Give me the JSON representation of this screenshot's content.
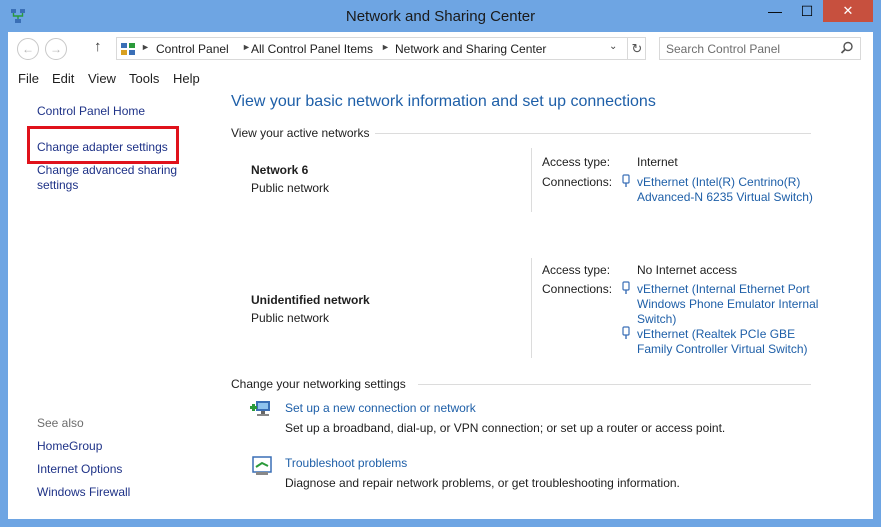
{
  "window": {
    "title": "Network and Sharing Center",
    "minimize_glyph": "—",
    "maximize_glyph": "☐",
    "close_glyph": "✕"
  },
  "navbar": {
    "back_glyph": "←",
    "forward_glyph": "→",
    "up_glyph": "↑",
    "breadcrumb": [
      "Control Panel",
      "All Control Panel Items",
      "Network and Sharing Center"
    ],
    "separator": "►",
    "dropdown_glyph": "⌄",
    "refresh_glyph": "↻",
    "search_placeholder": "Search Control Panel"
  },
  "menu": [
    "File",
    "Edit",
    "View",
    "Tools",
    "Help"
  ],
  "sidebar": {
    "home": "Control Panel Home",
    "change_adapter": "Change adapter settings",
    "change_sharing": "Change advanced sharing settings",
    "see_also_label": "See also",
    "see_also": [
      "HomeGroup",
      "Internet Options",
      "Windows Firewall"
    ]
  },
  "main": {
    "title": "View your basic network information and set up connections",
    "active_networks_label": "View your active networks",
    "networks": [
      {
        "name": "Network  6",
        "type": "Public network",
        "access_label": "Access type:",
        "access_value": "Internet",
        "connections_label": "Connections:",
        "connections": [
          "vEthernet (Intel(R) Centrino(R) Advanced-N 6235 Virtual Switch)"
        ]
      },
      {
        "name": "Unidentified network",
        "type": "Public network",
        "access_label": "Access type:",
        "access_value": "No Internet access",
        "connections_label": "Connections:",
        "connections": [
          "vEthernet (Internal Ethernet Port Windows Phone Emulator Internal Switch)",
          "vEthernet (Realtek PCIe GBE Family Controller Virtual Switch)"
        ]
      }
    ],
    "change_settings_label": "Change your networking settings",
    "tasks": [
      {
        "icon": "new-connection-icon",
        "link": "Set up a new connection or network",
        "description": "Set up a broadband, dial-up, or VPN connection; or set up a router or access point."
      },
      {
        "icon": "troubleshoot-icon",
        "link": "Troubleshoot problems",
        "description": "Diagnose and repair network problems, or get troubleshooting information."
      }
    ]
  },
  "colors": {
    "frame": "#6ea5e3",
    "link": "#1e5fa8",
    "highlight": "#e0121b",
    "close": "#c7503e"
  }
}
